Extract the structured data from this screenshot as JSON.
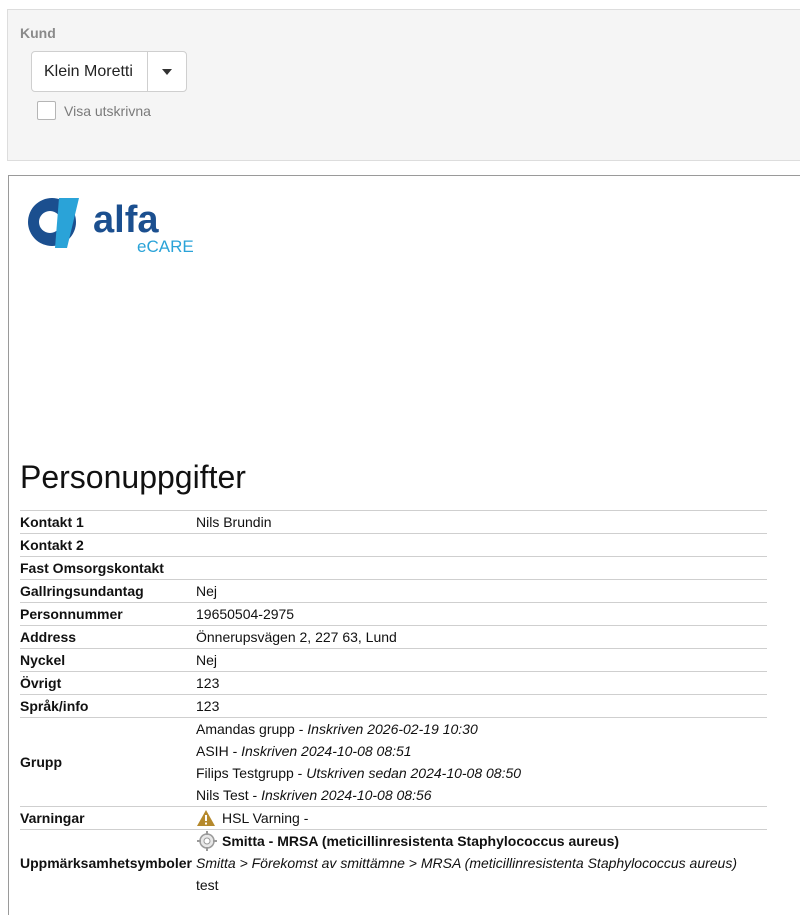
{
  "filter": {
    "label": "Kund",
    "customer_value": "Klein Moretti",
    "checkbox_label": "Visa utskrivna"
  },
  "logo": {
    "brand": "alfa",
    "sub": "eCARE",
    "colors": {
      "primary": "#1b4f8f",
      "accent": "#2aa3d8"
    }
  },
  "page_title": "Personuppgifter",
  "rows": {
    "kontakt1": {
      "label": "Kontakt 1",
      "value": "Nils Brundin"
    },
    "kontakt2": {
      "label": "Kontakt 2",
      "value": ""
    },
    "fast": {
      "label": "Fast Omsorgskontakt",
      "value": ""
    },
    "gallring": {
      "label": "Gallringsundantag",
      "value": "Nej"
    },
    "personnummer": {
      "label": "Personnummer",
      "value": "19650504-2975"
    },
    "address": {
      "label": "Address",
      "value": "Önnerupsvägen 2, 227 63, Lund"
    },
    "nyckel": {
      "label": "Nyckel",
      "value": "Nej"
    },
    "ovrigt": {
      "label": "Övrigt",
      "value": "123"
    },
    "sprak": {
      "label": "Språk/info",
      "value": "123"
    },
    "grupp": {
      "label": "Grupp",
      "items": [
        {
          "name": "Amandas grupp",
          "sep": " - ",
          "status": "Inskriven 2026-02-19 10:30"
        },
        {
          "name": "ASIH",
          "sep": " - ",
          "status": "Inskriven 2024-10-08 08:51"
        },
        {
          "name": "Filips Testgrupp",
          "sep": " - ",
          "status": "Utskriven sedan 2024-10-08 08:50"
        },
        {
          "name": "Nils Test",
          "sep": " - ",
          "status": "Inskriven 2024-10-08 08:56"
        }
      ]
    },
    "varningar": {
      "label": "Varningar",
      "value": "HSL Varning -"
    },
    "symboler": {
      "label": "Uppmärksamhetsymboler",
      "title": "Smitta - MRSA (meticillinresistenta Staphylococcus aureus)",
      "path": "Smitta > Förekomst av smittämne > MRSA (meticillinresistenta Staphylococcus aureus)",
      "note": "test"
    }
  }
}
